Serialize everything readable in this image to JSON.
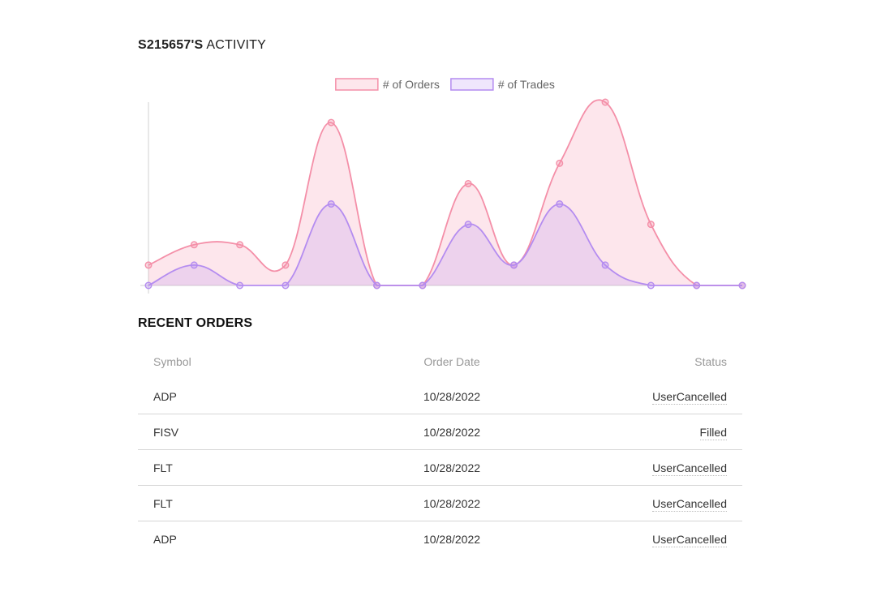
{
  "activity": {
    "user": "S215657'S",
    "suffix": "ACTIVITY"
  },
  "chart_data": {
    "type": "area",
    "x": [
      0,
      1,
      2,
      3,
      4,
      5,
      6,
      7,
      8,
      9,
      10,
      11,
      12,
      13
    ],
    "series": [
      {
        "name": "# of Orders",
        "values": [
          1,
          2,
          2,
          1,
          8,
          0,
          0,
          5,
          1,
          6,
          9,
          3,
          0,
          0
        ],
        "color": "#f48fa8"
      },
      {
        "name": "# of Trades",
        "values": [
          0,
          1,
          0,
          0,
          4,
          0,
          0,
          3,
          1,
          4,
          1,
          0,
          0,
          0
        ],
        "color": "#b48cf0"
      }
    ],
    "ylim": [
      0,
      9
    ],
    "legend": "top-center",
    "grid": false
  },
  "orders": {
    "title": "RECENT ORDERS",
    "columns": [
      "Symbol",
      "Order Date",
      "Status"
    ],
    "rows": [
      {
        "symbol": "ADP",
        "date": "10/28/2022",
        "status": "UserCancelled"
      },
      {
        "symbol": "FISV",
        "date": "10/28/2022",
        "status": "Filled"
      },
      {
        "symbol": "FLT",
        "date": "10/28/2022",
        "status": "UserCancelled"
      },
      {
        "symbol": "FLT",
        "date": "10/28/2022",
        "status": "UserCancelled"
      },
      {
        "symbol": "ADP",
        "date": "10/28/2022",
        "status": "UserCancelled"
      }
    ]
  }
}
